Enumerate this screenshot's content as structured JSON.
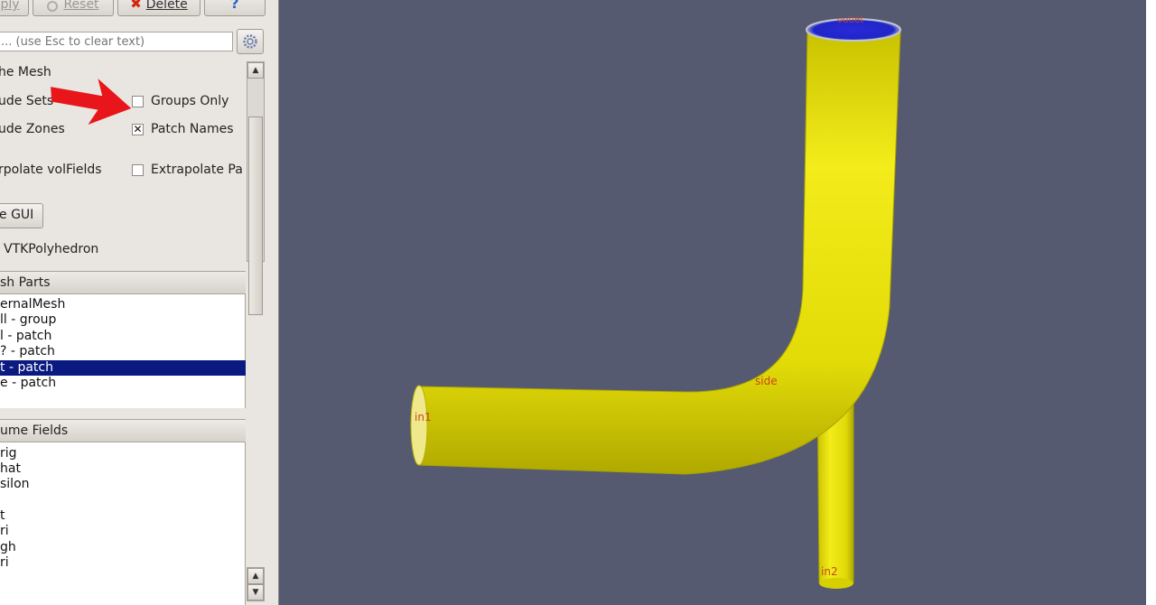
{
  "toolbar": {
    "apply_label": "ply",
    "reset_label": "Reset",
    "delete_label": "Delete",
    "help_label": "?"
  },
  "search": {
    "placeholder": "... (use Esc to clear text)"
  },
  "properties": {
    "section_title": "he Mesh",
    "include_sets_label": "ude Sets",
    "include_zones_label": "ude Zones",
    "groups_only_label": "Groups Only",
    "groups_only_checked": false,
    "patch_names_label": "Patch Names",
    "patch_names_checked": true,
    "interpolate_label": "rpolate volFields",
    "extrapolate_label": "Extrapolate Pa",
    "extrapolate_checked": false,
    "gui_button_label": "e GUI",
    "polyhedron_label": "VTKPolyhedron",
    "check_mark": "✕"
  },
  "mesh_parts": {
    "header": "sh Parts",
    "items": [
      {
        "label": "ernalMesh",
        "selected": false
      },
      {
        "label": "ll - group",
        "selected": false
      },
      {
        "label": "l - patch",
        "selected": false
      },
      {
        "label": "? - patch",
        "selected": false
      },
      {
        "label": "t - patch",
        "selected": true
      },
      {
        "label": "e - patch",
        "selected": false
      }
    ]
  },
  "volume_fields": {
    "header": "ume Fields",
    "items": [
      "rig",
      "hat",
      "silon",
      "",
      "t",
      "ri",
      "gh",
      "ri"
    ]
  },
  "viewport": {
    "background_color": "#555a70",
    "pipe_color": "#e6e010",
    "patch_labels": {
      "inlet1": "in1",
      "side": "side",
      "inlet2": "in2",
      "outlet": "outlet"
    }
  },
  "colors": {
    "arrow": "#e8161a",
    "selection": "#0a1a80"
  }
}
